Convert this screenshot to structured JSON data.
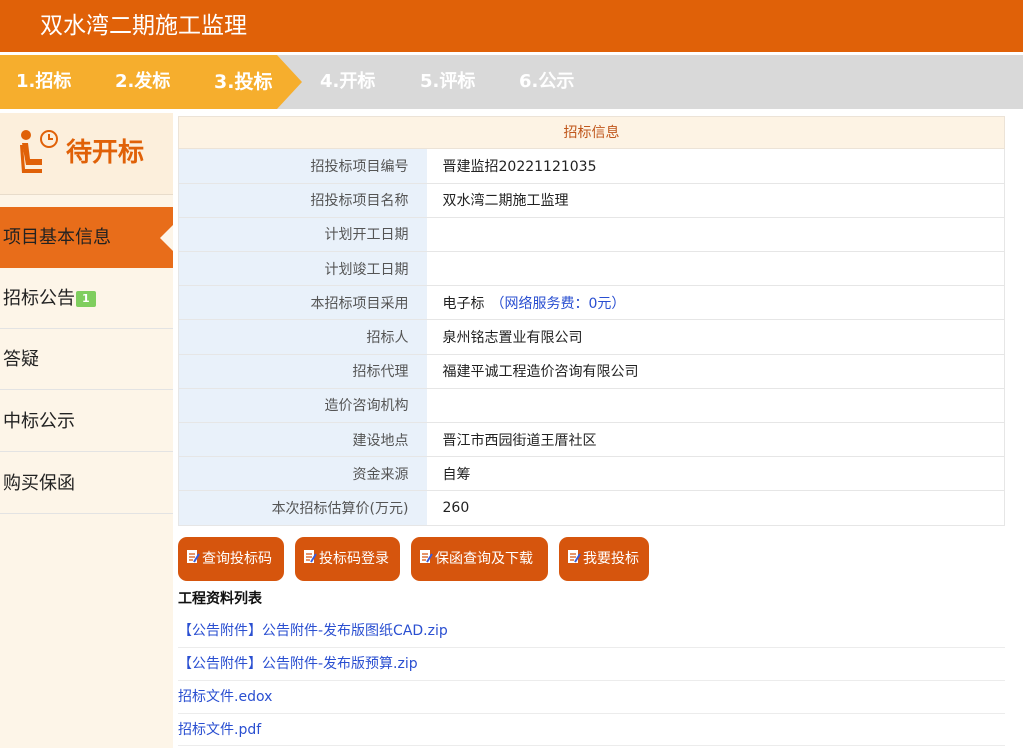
{
  "header": {
    "title": "双水湾二期施工监理"
  },
  "steps": [
    {
      "label": "1.招标",
      "active": true
    },
    {
      "label": "2.发标",
      "active": true
    },
    {
      "label": "3.投标",
      "active": true
    },
    {
      "label": "4.开标",
      "active": false
    },
    {
      "label": "5.评标",
      "active": false
    },
    {
      "label": "6.公示",
      "active": false
    }
  ],
  "status": {
    "text": "待开标",
    "icon": "seat-clock-icon"
  },
  "sidebar": {
    "items": [
      {
        "label": "项目基本信息",
        "active": true
      },
      {
        "label": "招标公告",
        "badge": "1"
      },
      {
        "label": "答疑"
      },
      {
        "label": "中标公示"
      },
      {
        "label": "购买保函"
      }
    ]
  },
  "info": {
    "title": "招标信息",
    "rows": [
      {
        "label": "招投标项目编号",
        "value": "晋建监招20221121035"
      },
      {
        "label": "招投标项目名称",
        "value": "双水湾二期施工监理"
      },
      {
        "label": "计划开工日期",
        "value": ""
      },
      {
        "label": "计划竣工日期",
        "value": ""
      },
      {
        "label": "本招标项目采用",
        "value": "电子标",
        "note": "（网络服务费：0元）"
      },
      {
        "label": "招标人",
        "value": "泉州铭志置业有限公司"
      },
      {
        "label": "招标代理",
        "value": "福建平诚工程造价咨询有限公司"
      },
      {
        "label": "造价咨询机构",
        "value": ""
      },
      {
        "label": "建设地点",
        "value": "晋江市西园街道王厝社区"
      },
      {
        "label": "资金来源",
        "value": "自筹"
      },
      {
        "label": "本次招标估算价(万元)",
        "value": "260"
      }
    ]
  },
  "buttons": [
    {
      "label": "查询投标码"
    },
    {
      "label": "投标码登录"
    },
    {
      "label": "保函查询及下载"
    },
    {
      "label": "我要投标"
    }
  ],
  "files": {
    "title": "工程资料列表",
    "items": [
      "【公告附件】公告附件-发布版图纸CAD.zip",
      "【公告附件】公告附件-发布版预算.zip",
      "招标文件.edox",
      "招标文件.pdf"
    ]
  },
  "colors": {
    "brand": "#e06108",
    "active_step": "#f6ae2d",
    "link": "#2a4fd1",
    "button": "#d6550d"
  }
}
